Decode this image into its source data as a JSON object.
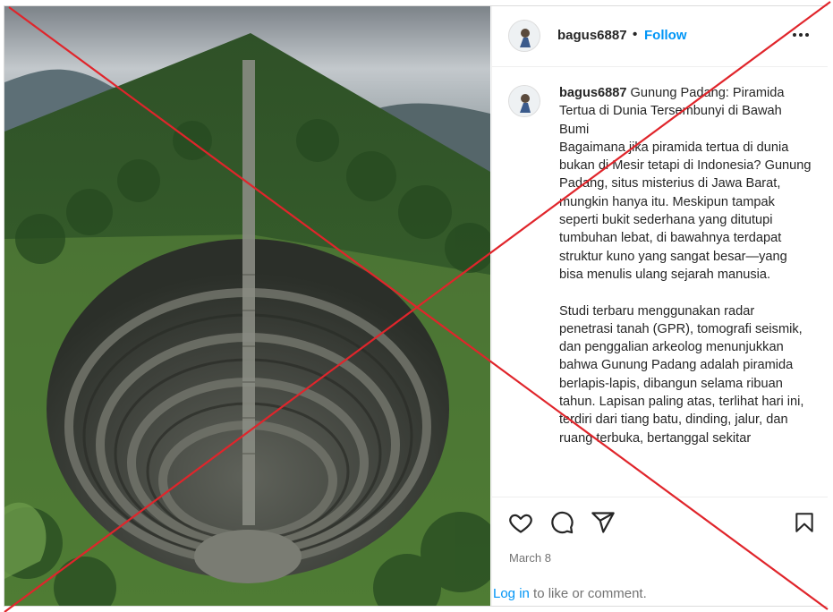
{
  "post": {
    "username": "bagus6887",
    "separator": "•",
    "follow_label": "Follow",
    "more_icon": "more-horizontal-icon",
    "image_alt": "Gunung Padang terraced pyramid on a forested hill"
  },
  "caption": {
    "username": "bagus6887",
    "text": " Gunung Padang: Piramida Tertua di Dunia Tersembunyi di Bawah Bumi\nBagaimana jika piramida tertua di dunia bukan di Mesir tetapi di Indonesia? Gunung Padang, situs misterius di Jawa Barat, mungkin hanya itu. Meskipun tampak seperti bukit sederhana yang ditutupi tumbuhan lebat, di bawahnya terdapat struktur kuno yang sangat besar—yang bisa menulis ulang sejarah manusia.\n\nStudi terbaru menggunakan radar penetrasi tanah (GPR), tomografi seismik, dan penggalian arkeolog menunjukkan bahwa Gunung Padang adalah piramida berlapis-lapis, dibangun selama ribuan tahun. Lapisan paling atas, terlihat hari ini, terdiri dari tiang batu, dinding, jalur, dan ruang terbuka, bertanggal sekitar"
  },
  "actions": {
    "like_icon": "heart-icon",
    "comment_icon": "comment-icon",
    "share_icon": "share-icon",
    "save_icon": "bookmark-icon"
  },
  "date": "March 8",
  "login": {
    "link_label": "Log in",
    "suffix": " to like or comment."
  },
  "colors": {
    "link_blue": "#0095f6",
    "overlay_red": "#e0252b",
    "muted_text": "#737373"
  }
}
